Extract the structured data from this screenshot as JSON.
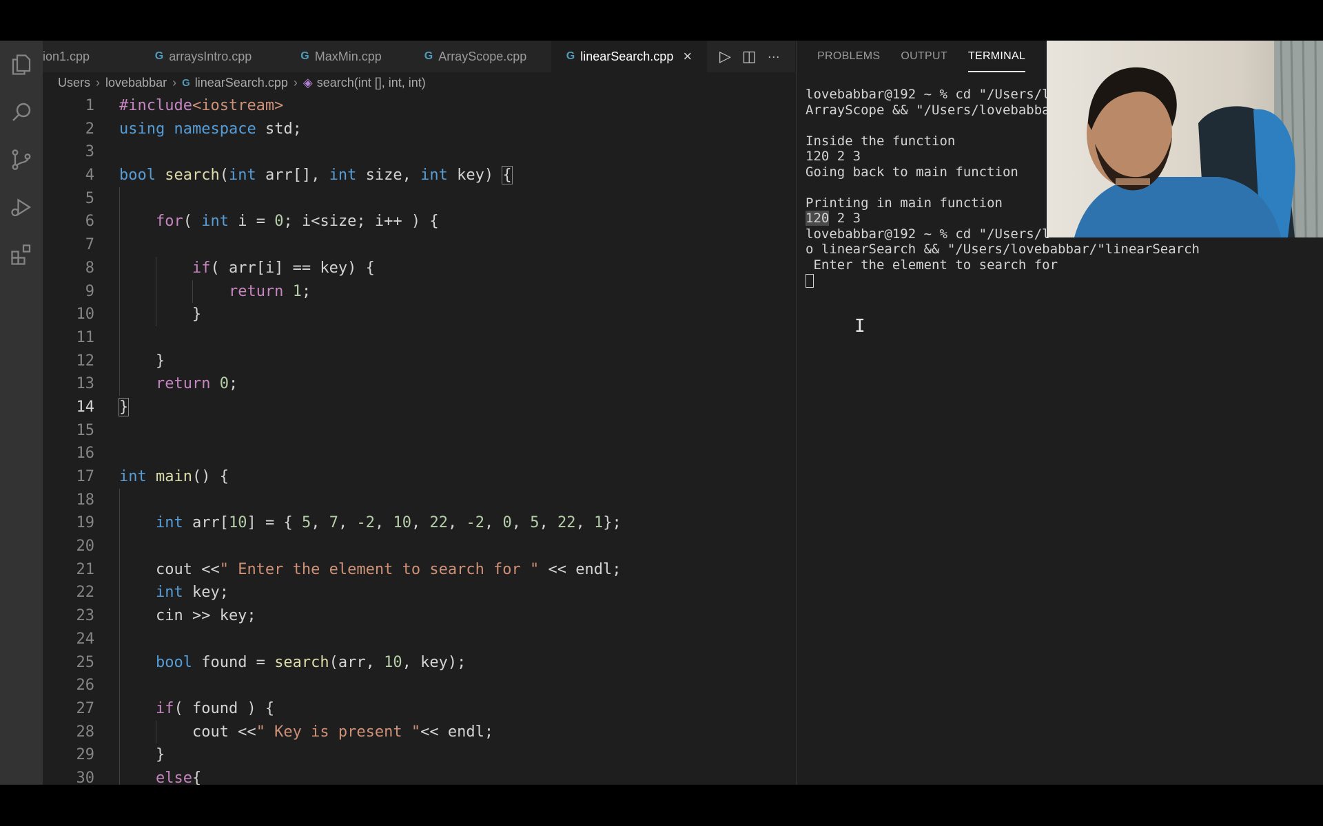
{
  "editor": {
    "tabs": [
      {
        "label": "ion1.cpp",
        "active": false
      },
      {
        "label": "arraysIntro.cpp",
        "active": false
      },
      {
        "label": "MaxMin.cpp",
        "active": false
      },
      {
        "label": "ArrayScope.cpp",
        "active": false
      },
      {
        "label": "linearSearch.cpp",
        "active": true
      }
    ],
    "close_glyph": "×",
    "actions": {
      "run": "▷",
      "split": "◫",
      "more": "···"
    },
    "breadcrumb": {
      "users": "Users",
      "user": "lovebabbar",
      "file": "linearSearch.cpp",
      "symbol": "search(int [], int, int)"
    },
    "current_line": 14
  },
  "code": [
    [
      [
        "c",
        "#include"
      ],
      [
        "s",
        "<iostream>"
      ]
    ],
    [
      [
        "k",
        "using"
      ],
      [
        "p",
        " "
      ],
      [
        "k",
        "namespace"
      ],
      [
        "p",
        " std;"
      ]
    ],
    [],
    [
      [
        "t",
        "bool"
      ],
      [
        "p",
        " "
      ],
      [
        "f",
        "search"
      ],
      [
        "p",
        "("
      ],
      [
        "t",
        "int"
      ],
      [
        "p",
        " arr[], "
      ],
      [
        "t",
        "int"
      ],
      [
        "p",
        " size, "
      ],
      [
        "t",
        "int"
      ],
      [
        "p",
        " key) "
      ],
      [
        "bm",
        "{"
      ]
    ],
    [],
    [
      [
        "p",
        "    "
      ],
      [
        "c",
        "for"
      ],
      [
        "p",
        "( "
      ],
      [
        "t",
        "int"
      ],
      [
        "p",
        " i = "
      ],
      [
        "n",
        "0"
      ],
      [
        "p",
        "; i<size; i++ ) {"
      ]
    ],
    [],
    [
      [
        "p",
        "        "
      ],
      [
        "c",
        "if"
      ],
      [
        "p",
        "( arr[i] == key) {"
      ]
    ],
    [
      [
        "p",
        "            "
      ],
      [
        "c",
        "return"
      ],
      [
        "p",
        " "
      ],
      [
        "n",
        "1"
      ],
      [
        "p",
        ";"
      ]
    ],
    [
      [
        "p",
        "        }"
      ]
    ],
    [],
    [
      [
        "p",
        "    }"
      ]
    ],
    [
      [
        "p",
        "    "
      ],
      [
        "c",
        "return"
      ],
      [
        "p",
        " "
      ],
      [
        "n",
        "0"
      ],
      [
        "p",
        ";"
      ]
    ],
    [
      [
        "bm",
        "}"
      ]
    ],
    [],
    [],
    [
      [
        "t",
        "int"
      ],
      [
        "p",
        " "
      ],
      [
        "f",
        "main"
      ],
      [
        "p",
        "() {"
      ]
    ],
    [],
    [
      [
        "p",
        "    "
      ],
      [
        "t",
        "int"
      ],
      [
        "p",
        " arr["
      ],
      [
        "n",
        "10"
      ],
      [
        "p",
        "] = { "
      ],
      [
        "n",
        "5"
      ],
      [
        "p",
        ", "
      ],
      [
        "n",
        "7"
      ],
      [
        "p",
        ", "
      ],
      [
        "n",
        "-2"
      ],
      [
        "p",
        ", "
      ],
      [
        "n",
        "10"
      ],
      [
        "p",
        ", "
      ],
      [
        "n",
        "22"
      ],
      [
        "p",
        ", "
      ],
      [
        "n",
        "-2"
      ],
      [
        "p",
        ", "
      ],
      [
        "n",
        "0"
      ],
      [
        "p",
        ", "
      ],
      [
        "n",
        "5"
      ],
      [
        "p",
        ", "
      ],
      [
        "n",
        "22"
      ],
      [
        "p",
        ", "
      ],
      [
        "n",
        "1"
      ],
      [
        "p",
        "};"
      ]
    ],
    [],
    [
      [
        "p",
        "    cout <<"
      ],
      [
        "s",
        "\" Enter the element to search for \""
      ],
      [
        "p",
        " << endl;"
      ]
    ],
    [
      [
        "p",
        "    "
      ],
      [
        "t",
        "int"
      ],
      [
        "p",
        " key;"
      ]
    ],
    [
      [
        "p",
        "    cin >> key;"
      ]
    ],
    [],
    [
      [
        "p",
        "    "
      ],
      [
        "t",
        "bool"
      ],
      [
        "p",
        " found = "
      ],
      [
        "f",
        "search"
      ],
      [
        "p",
        "(arr, "
      ],
      [
        "n",
        "10"
      ],
      [
        "p",
        ", key);"
      ]
    ],
    [],
    [
      [
        "p",
        "    "
      ],
      [
        "c",
        "if"
      ],
      [
        "p",
        "( found ) {"
      ]
    ],
    [
      [
        "p",
        "        cout <<"
      ],
      [
        "s",
        "\" Key is present \""
      ],
      [
        "p",
        "<< endl;"
      ]
    ],
    [
      [
        "p",
        "    }"
      ]
    ],
    [
      [
        "p",
        "    "
      ],
      [
        "c",
        "else"
      ],
      [
        "p",
        "{"
      ]
    ]
  ],
  "panel": {
    "tabs": [
      "PROBLEMS",
      "OUTPUT",
      "TERMINAL"
    ],
    "active_tab": "TERMINAL",
    "terminal_lines": [
      "lovebabbar@192 ~ % cd \"/Users/l",
      "ArrayScope && \"/Users/lovebabba",
      "",
      "Inside the function",
      "120 2 3",
      "Going back to main function",
      "",
      "Printing in main function",
      "120 2 3",
      "lovebabbar@192 ~ % cd \"/Users/l",
      "o linearSearch && \"/Users/lovebabbar/\"linearSearch",
      " Enter the element to search for"
    ]
  },
  "colors": {
    "editor_bg": "#1e1e1e",
    "activity_bar": "#333333",
    "keyword_blue": "#569cd6",
    "control_purple": "#c586c0",
    "string_orange": "#ce9178",
    "number_green": "#b5cea8",
    "cpp_icon": "#519aba"
  },
  "icons": [
    "explorer-icon",
    "search-icon",
    "source-control-icon",
    "run-debug-icon",
    "extensions-icon",
    "cpp-file-icon",
    "close-icon",
    "run-icon",
    "split-editor-icon",
    "more-icon",
    "symbol-method-icon"
  ]
}
